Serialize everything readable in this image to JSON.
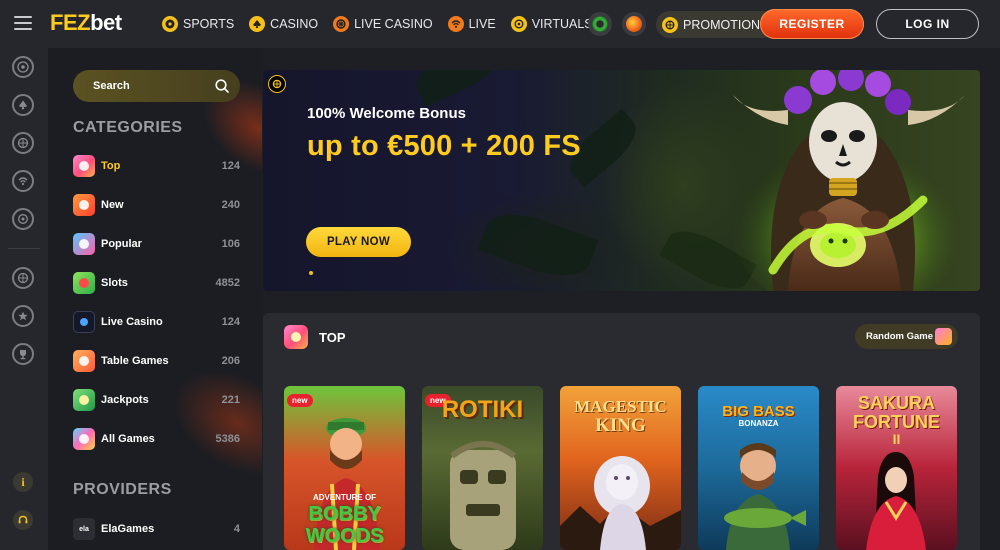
{
  "header": {
    "logo_part1": "FEZ",
    "logo_part2": "bet",
    "nav": [
      {
        "label": "SPORTS",
        "icon": "soccer-ball-icon"
      },
      {
        "label": "CASINO",
        "icon": "spade-icon"
      },
      {
        "label": "LIVE CASINO",
        "icon": "roulette-icon"
      },
      {
        "label": "LIVE",
        "icon": "live-signal-icon"
      },
      {
        "label": "VIRTUALS",
        "icon": "virtuals-icon"
      }
    ],
    "promotions_label": "PROMOTIONS",
    "register_label": "REGISTER",
    "login_label": "LOG IN"
  },
  "search": {
    "placeholder": "Search"
  },
  "categories_title": "CATEGORIES",
  "categories": [
    {
      "label": "Top",
      "count": "124",
      "active": true,
      "color": "#ff6fb0"
    },
    {
      "label": "New",
      "count": "240",
      "active": false,
      "color": "#ff5a36"
    },
    {
      "label": "Popular",
      "count": "106",
      "active": false,
      "color": "#ff5fa8"
    },
    {
      "label": "Slots",
      "count": "4852",
      "active": false,
      "color": "#55c95a"
    },
    {
      "label": "Live Casino",
      "count": "124",
      "active": false,
      "color": "#1c2030"
    },
    {
      "label": "Table Games",
      "count": "206",
      "active": false,
      "color": "#ff7a4a"
    },
    {
      "label": "Jackpots",
      "count": "221",
      "active": false,
      "color": "#3ec26a"
    },
    {
      "label": "All Games",
      "count": "5386",
      "active": false,
      "color": "#ff6bb8"
    }
  ],
  "providers_title": "PROVIDERS",
  "providers": [
    {
      "label": "ElaGames",
      "count": "4",
      "logo": "ela"
    }
  ],
  "banner": {
    "subtitle": "100% Welcome Bonus",
    "title": "up to €500 + 200 FS",
    "cta": "PLAY NOW"
  },
  "top_section": {
    "title": "TOP",
    "random_label": "Random Game"
  },
  "games": [
    {
      "name": "Adventure of Bobby Woods",
      "title_lines": [
        "BOBBY",
        "WOODS"
      ],
      "badge": "new",
      "bg": "#d2552b",
      "accent": "#47c948"
    },
    {
      "name": "Rotiki",
      "title_lines": [
        "ROTIKI"
      ],
      "badge": "new",
      "bg": "#5a6a34",
      "accent": "#f2a51a"
    },
    {
      "name": "Magestic King",
      "title_lines": [
        "MAGESTIC",
        "KING"
      ],
      "badge": "",
      "bg": "#c9611d",
      "accent": "#ffd76a"
    },
    {
      "name": "Big Bass Bonanza",
      "title_lines": [
        "BIG BASS",
        "BONANZA"
      ],
      "badge": "",
      "bg": "#1d6a9a",
      "accent": "#ffb31a"
    },
    {
      "name": "Sakura Fortune II",
      "title_lines": [
        "SAKURA",
        "FORTUNE"
      ],
      "badge": "",
      "bg": "#b8243a",
      "accent": "#ffd35a"
    }
  ]
}
